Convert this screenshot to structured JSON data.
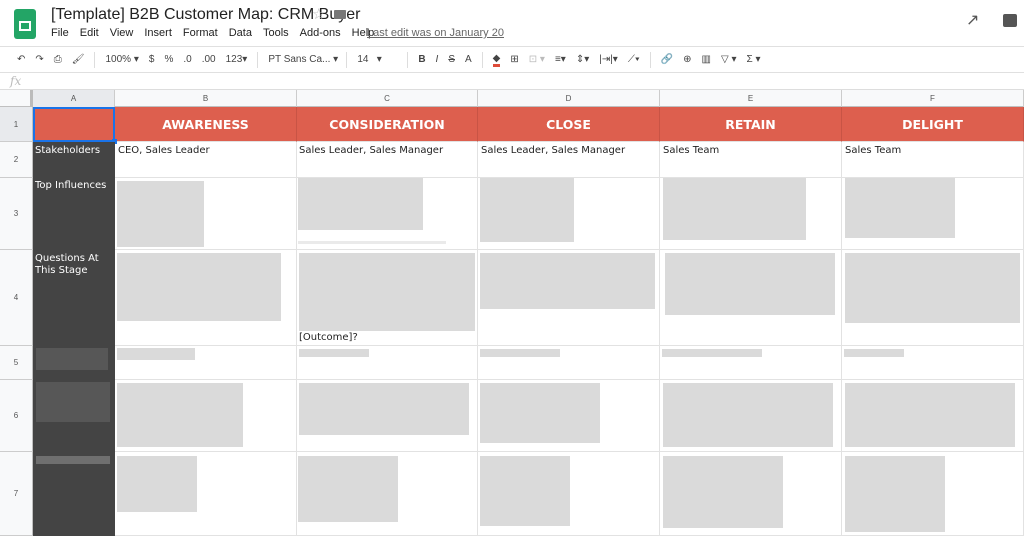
{
  "app": {
    "title": "[Template] B2B Customer Map: CRM Buyer",
    "last_edit": "Last edit was on January 20",
    "menu": [
      "File",
      "Edit",
      "View",
      "Insert",
      "Format",
      "Data",
      "Tools",
      "Add-ons",
      "Help"
    ]
  },
  "toolbar": {
    "zoom": "100%",
    "currency": "$",
    "percent": "%",
    "dec_decrease": ".0",
    "dec_increase": ".00",
    "format": "123",
    "font": "PT Sans Ca...",
    "font_size": "14",
    "bold": "B",
    "italic": "I",
    "strike": "S",
    "text_color": "A",
    "fill_accent": "#dd4b39"
  },
  "formula_bar": {
    "fx": "fx",
    "value": ""
  },
  "columns": [
    "A",
    "B",
    "C",
    "D",
    "E",
    "F"
  ],
  "rows": [
    "1",
    "2",
    "3",
    "4",
    "5",
    "6",
    "7"
  ],
  "header_row": [
    "",
    "AWARENESS",
    "CONSIDERATION",
    "CLOSE",
    "RETAIN",
    "DELIGHT"
  ],
  "labels": [
    "Stakeholders",
    "Top Influences",
    "Questions At This Stage"
  ],
  "stakeholders": [
    "CEO, Sales Leader",
    "Sales Leader, Sales Manager",
    "Sales Leader, Sales Manager",
    "Sales Team",
    "Sales Team"
  ],
  "visible_fragments": {
    "c4": "[Outcome]?"
  },
  "colors": {
    "header_bg": "#dd5f4e",
    "label_bg": "#444444",
    "selection": "#1a73e8"
  }
}
